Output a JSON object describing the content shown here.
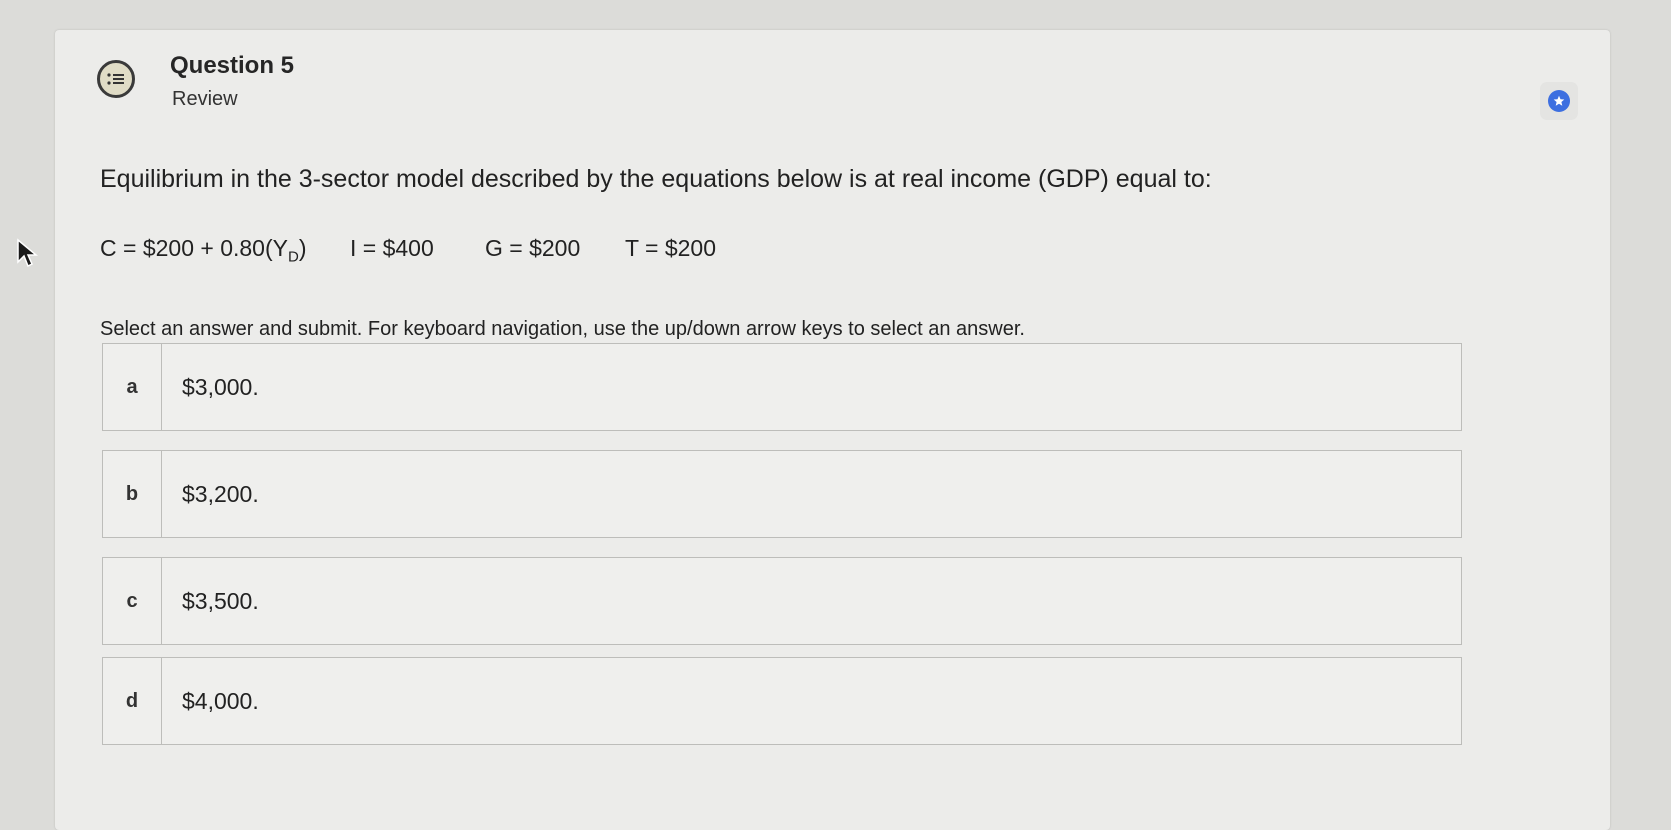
{
  "question": {
    "title": "Question 5",
    "subtitle": "Review",
    "icon": "question-list-icon",
    "flag_icon": "star-icon"
  },
  "prompt": "Equilibrium in the 3-sector model described by the equations below is at real income (GDP) equal to:",
  "equations": {
    "consumption_prefix": "C = $200 + 0.80(Y",
    "consumption_sub": "D",
    "consumption_suffix": ")",
    "investment": "I = $400",
    "government": "G = $200",
    "taxes": "T = $200"
  },
  "instructions": "Select an answer and submit. For keyboard navigation, use the up/down arrow keys to select an answer.",
  "options": [
    {
      "letter": "a",
      "text": "$3,000."
    },
    {
      "letter": "b",
      "text": "$3,200."
    },
    {
      "letter": "c",
      "text": "$3,500."
    },
    {
      "letter": "d",
      "text": "$4,000."
    }
  ],
  "colors": {
    "accent": "#3d6fe0",
    "background": "#ececea"
  }
}
